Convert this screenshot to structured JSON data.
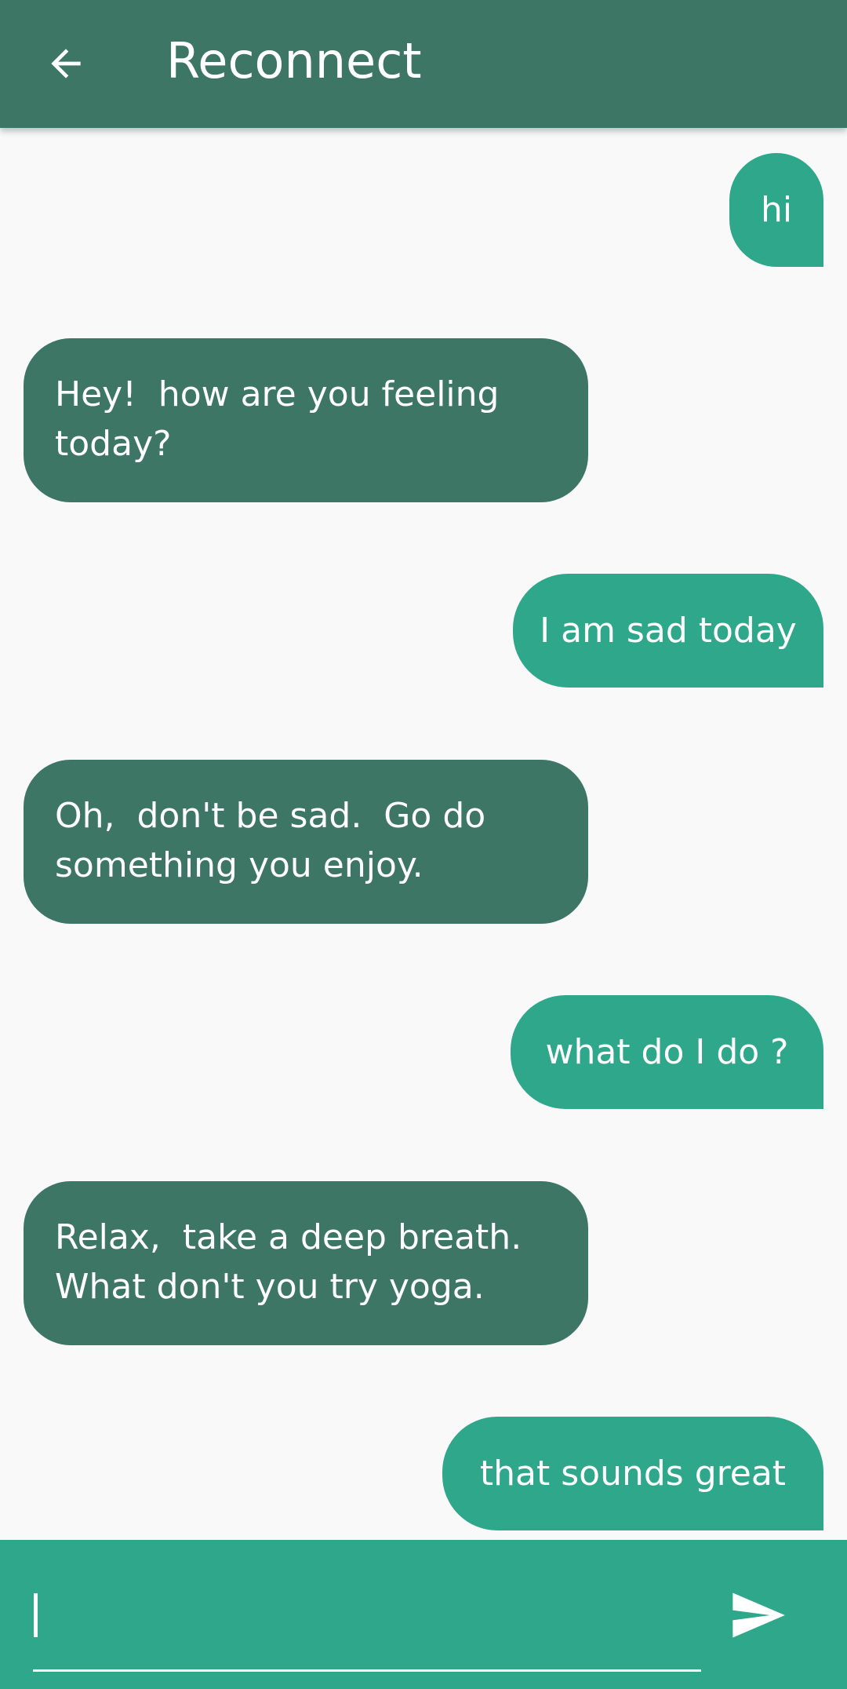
{
  "app": {
    "title": "Reconnect"
  },
  "colors": {
    "header": "#3d7665",
    "user_bubble": "#2ea78a",
    "bot_bubble": "#3d7665",
    "input_bar": "#2ea78a",
    "background": "#f9f9f9"
  },
  "icons": {
    "back": "arrow-left-icon",
    "send": "send-icon"
  },
  "messages": [
    {
      "sender": "user",
      "text": "hi"
    },
    {
      "sender": "bot",
      "text": "Hey!  how are you feeling today?"
    },
    {
      "sender": "user",
      "text": "I am sad today"
    },
    {
      "sender": "bot",
      "text": "Oh,  don't be sad.  Go do something you enjoy."
    },
    {
      "sender": "user",
      "text": "what do I do ?"
    },
    {
      "sender": "bot",
      "text": "Relax,  take a deep breath.  What don't you try yoga."
    },
    {
      "sender": "user",
      "text": "that sounds great"
    }
  ],
  "composer": {
    "value": "",
    "placeholder": ""
  }
}
